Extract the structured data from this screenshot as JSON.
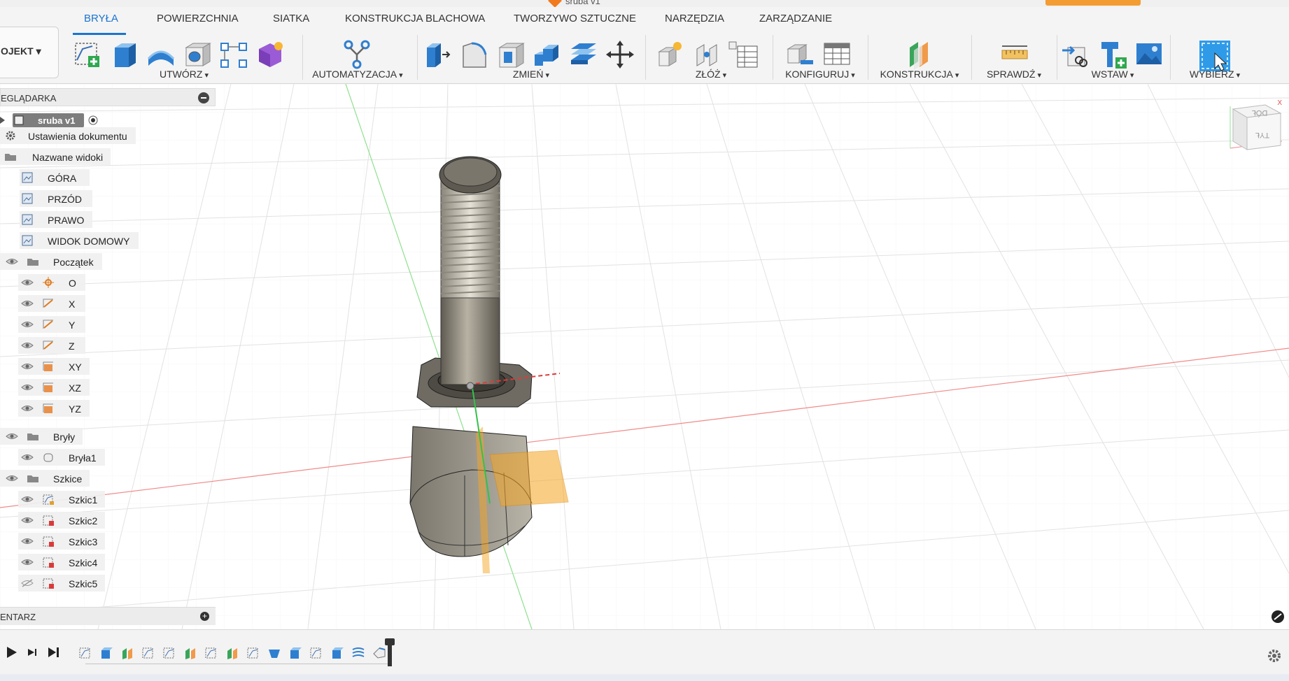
{
  "window": {
    "title": "sruba v1"
  },
  "ribbon": {
    "tabs": [
      "BRYŁA",
      "POWIERZCHNIA",
      "SIATKA",
      "KONSTRUKCJA BLACHOWA",
      "TWORZYWO SZTUCZNE",
      "NARZĘDZIA",
      "ZARZĄDZANIE"
    ],
    "active_tab": "BRYŁA",
    "project_label": "OJEKT ▾",
    "groups": {
      "create": "UTWÓRZ",
      "automate": "AUTOMATYZACJA",
      "modify": "ZMIEŃ",
      "assemble": "ZŁÓŻ",
      "configure": "KONFIGURUJ",
      "construct": "KONSTRUKCJA",
      "inspect": "SPRAWDŹ",
      "insert": "WSTAW",
      "select": "WYBIERZ"
    },
    "accent_color": "#1b74d0"
  },
  "browser": {
    "title": "EGLĄDARKA",
    "root": "sruba v1",
    "document_settings": "Ustawienia dokumentu",
    "named_views": {
      "label": "Nazwane widoki",
      "items": [
        "GÓRA",
        "PRZÓD",
        "PRAWO",
        "WIDOK DOMOWY"
      ]
    },
    "origin": {
      "label": "Początek",
      "items": [
        "O",
        "X",
        "Y",
        "Z",
        "XY",
        "XZ",
        "YZ"
      ]
    },
    "bodies": {
      "label": "Bryły",
      "items": [
        "Bryła1"
      ]
    },
    "sketches": {
      "label": "Szkice",
      "items": [
        "Szkic1",
        "Szkic2",
        "Szkic3",
        "Szkic4",
        "Szkic5"
      ],
      "hidden": [
        "Szkic5"
      ]
    }
  },
  "comments": {
    "title": "ENTARZ"
  },
  "viewcube": {
    "top_face": "DÓŁ",
    "front_face": "TYŁ",
    "axis": "X"
  },
  "timeline": {
    "controls": [
      "play-icon",
      "step-forward-icon",
      "go-to-end-icon"
    ],
    "features": [
      "sketch",
      "extrude",
      "plane",
      "sketch",
      "sketch",
      "plane",
      "sketch",
      "plane",
      "sketch",
      "fillet",
      "extrude",
      "sketch",
      "extrude",
      "coil",
      "chamfer"
    ]
  }
}
